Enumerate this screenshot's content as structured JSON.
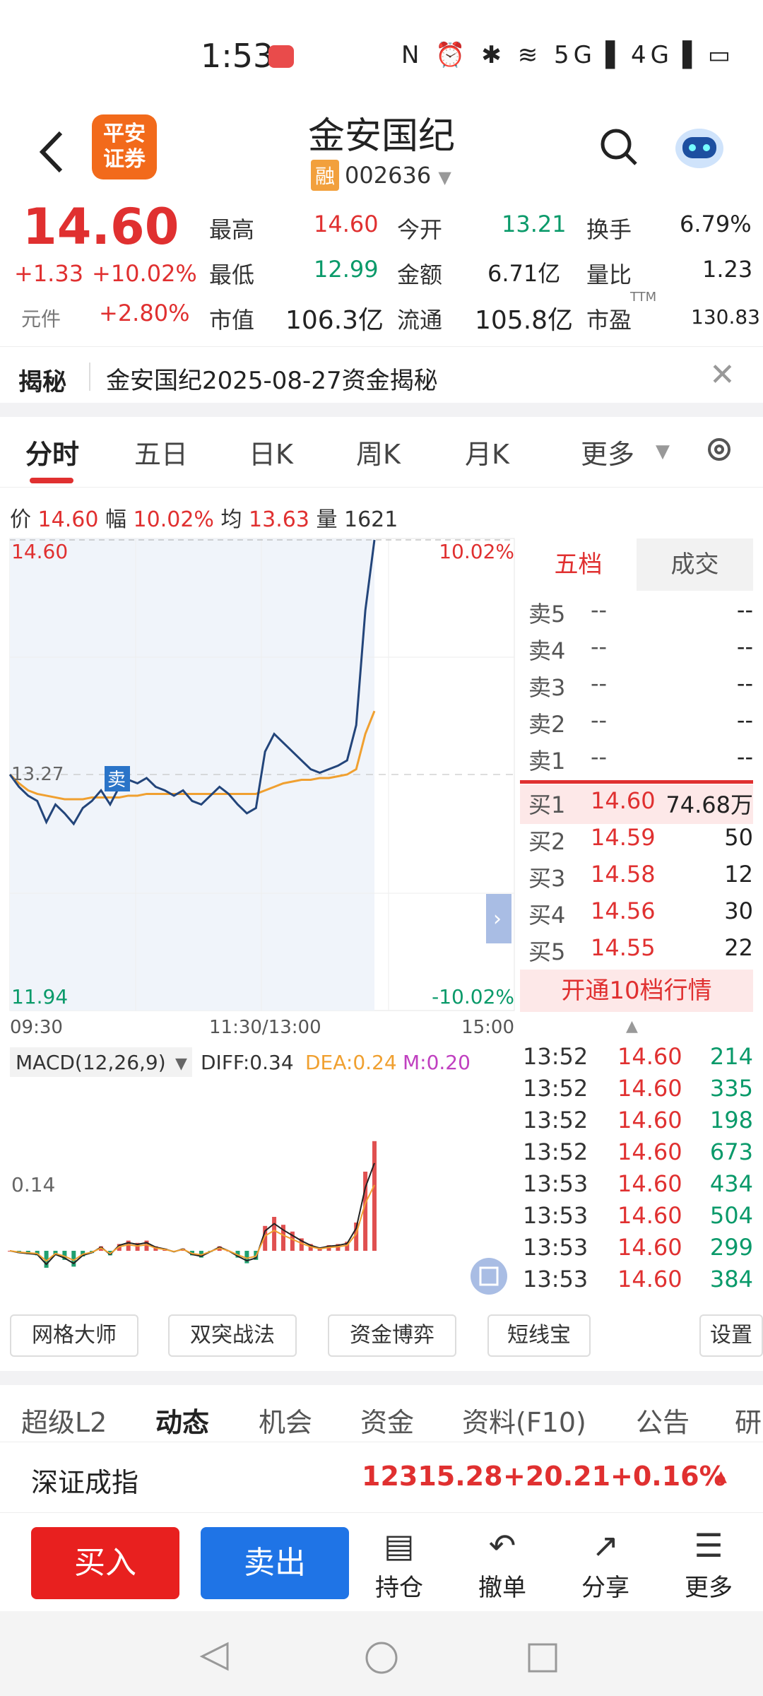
{
  "status_bar": {
    "time": "1:53",
    "icons": "N ⏰ ✱ ≋ 5G▐ 4G▐ ▭"
  },
  "header": {
    "title": "金安国纪",
    "rong": "融",
    "code": "002636",
    "logo_text_1": "平安",
    "logo_text_2": "证券"
  },
  "quote": {
    "price": "14.60",
    "change": "+1.33",
    "change_pct": "+10.02%",
    "yuanjian_label": "元件",
    "yuanjian_value": "+2.80%",
    "high_label": "最高",
    "high": "14.60",
    "open_label": "今开",
    "open": "13.21",
    "turnover_label": "换手",
    "turnover": "6.79%",
    "low_label": "最低",
    "low": "12.99",
    "amount_label": "金额",
    "amount": "6.71亿",
    "vol_ratio_label": "量比",
    "vol_ratio": "1.23",
    "mktcap_label": "市值",
    "mktcap": "106.3亿",
    "float_label": "流通",
    "float": "105.8亿",
    "pe_label": "市盈",
    "pe_sup": "TTM",
    "pe": "130.83"
  },
  "reveal": {
    "title": "揭秘",
    "message": "金安国纪2025-08-27资金揭秘"
  },
  "tabs": [
    "分时",
    "五日",
    "日K",
    "周K",
    "月K",
    "更多"
  ],
  "info_line": {
    "price_label": "价",
    "price": "14.60",
    "range_label": "幅",
    "range": "10.02%",
    "avg_label": "均",
    "avg": "13.63",
    "vol_label": "量",
    "vol": "1621"
  },
  "chart_labels": {
    "top_price": "14.60",
    "top_pct": "10.02%",
    "mid_price": "13.27",
    "bottom_price": "11.94",
    "bottom_pct": "-10.02%",
    "sell_marker": "卖",
    "time_start": "09:30",
    "time_mid": "11:30/13:00",
    "time_end": "15:00",
    "macd_name": "MACD(12,26,9)",
    "diff": "DIFF:0.34",
    "dea": "DEA:0.24",
    "m": "M:0.20",
    "macd_level": "0.14"
  },
  "chart_data": {
    "type": "line",
    "ylim": [
      11.94,
      14.6
    ],
    "prev_close": 13.27,
    "price_series": [
      13.27,
      13.2,
      13.15,
      13.12,
      13.0,
      13.1,
      13.05,
      12.99,
      13.08,
      13.12,
      13.18,
      13.1,
      13.2,
      13.24,
      13.22,
      13.25,
      13.2,
      13.18,
      13.15,
      13.18,
      13.12,
      13.1,
      13.15,
      13.2,
      13.16,
      13.1,
      13.05,
      13.08,
      13.4,
      13.5,
      13.45,
      13.4,
      13.35,
      13.3,
      13.28,
      13.3,
      13.32,
      13.35,
      13.55,
      14.2,
      14.6
    ],
    "avg_series": [
      13.27,
      13.22,
      13.18,
      13.16,
      13.15,
      13.14,
      13.13,
      13.13,
      13.13,
      13.14,
      13.14,
      13.14,
      13.14,
      13.15,
      13.15,
      13.16,
      13.16,
      13.16,
      13.16,
      13.16,
      13.16,
      13.16,
      13.16,
      13.16,
      13.16,
      13.16,
      13.16,
      13.16,
      13.18,
      13.2,
      13.22,
      13.23,
      13.24,
      13.24,
      13.25,
      13.25,
      13.26,
      13.27,
      13.3,
      13.5,
      13.63
    ]
  },
  "orderbook": {
    "tab_wudang": "五档",
    "tab_deal": "成交",
    "asks": [
      {
        "label": "卖5",
        "price": "--",
        "vol": "--"
      },
      {
        "label": "卖4",
        "price": "--",
        "vol": "--"
      },
      {
        "label": "卖3",
        "price": "--",
        "vol": "--"
      },
      {
        "label": "卖2",
        "price": "--",
        "vol": "--"
      },
      {
        "label": "卖1",
        "price": "--",
        "vol": "--"
      }
    ],
    "bids": [
      {
        "label": "买1",
        "price": "14.60",
        "vol": "74.68万"
      },
      {
        "label": "买2",
        "price": "14.59",
        "vol": "50"
      },
      {
        "label": "买3",
        "price": "14.58",
        "vol": "12"
      },
      {
        "label": "买4",
        "price": "14.56",
        "vol": "30"
      },
      {
        "label": "买5",
        "price": "14.55",
        "vol": "22"
      }
    ],
    "open_ten": "开通10档行情",
    "ticks": [
      {
        "time": "13:52",
        "price": "14.60",
        "vol": "214"
      },
      {
        "time": "13:52",
        "price": "14.60",
        "vol": "335"
      },
      {
        "time": "13:52",
        "price": "14.60",
        "vol": "198"
      },
      {
        "time": "13:52",
        "price": "14.60",
        "vol": "673"
      },
      {
        "time": "13:53",
        "price": "14.60",
        "vol": "434"
      },
      {
        "time": "13:53",
        "price": "14.60",
        "vol": "504"
      },
      {
        "time": "13:53",
        "price": "14.60",
        "vol": "299"
      },
      {
        "time": "13:53",
        "price": "14.60",
        "vol": "384"
      }
    ]
  },
  "tools": [
    "网格大师",
    "双突战法",
    "资金博弈",
    "短线宝",
    "设置"
  ],
  "subtabs": [
    "超级L2",
    "动态",
    "机会",
    "资金",
    "资料(F10)",
    "公告",
    "研"
  ],
  "index": {
    "name": "深证成指",
    "value": "12315.28",
    "change": "+20.21",
    "pct": "+0.16%"
  },
  "bottom": {
    "buy": "买入",
    "sell": "卖出",
    "hold": "持仓",
    "cancel": "撤单",
    "share": "分享",
    "more": "更多"
  }
}
